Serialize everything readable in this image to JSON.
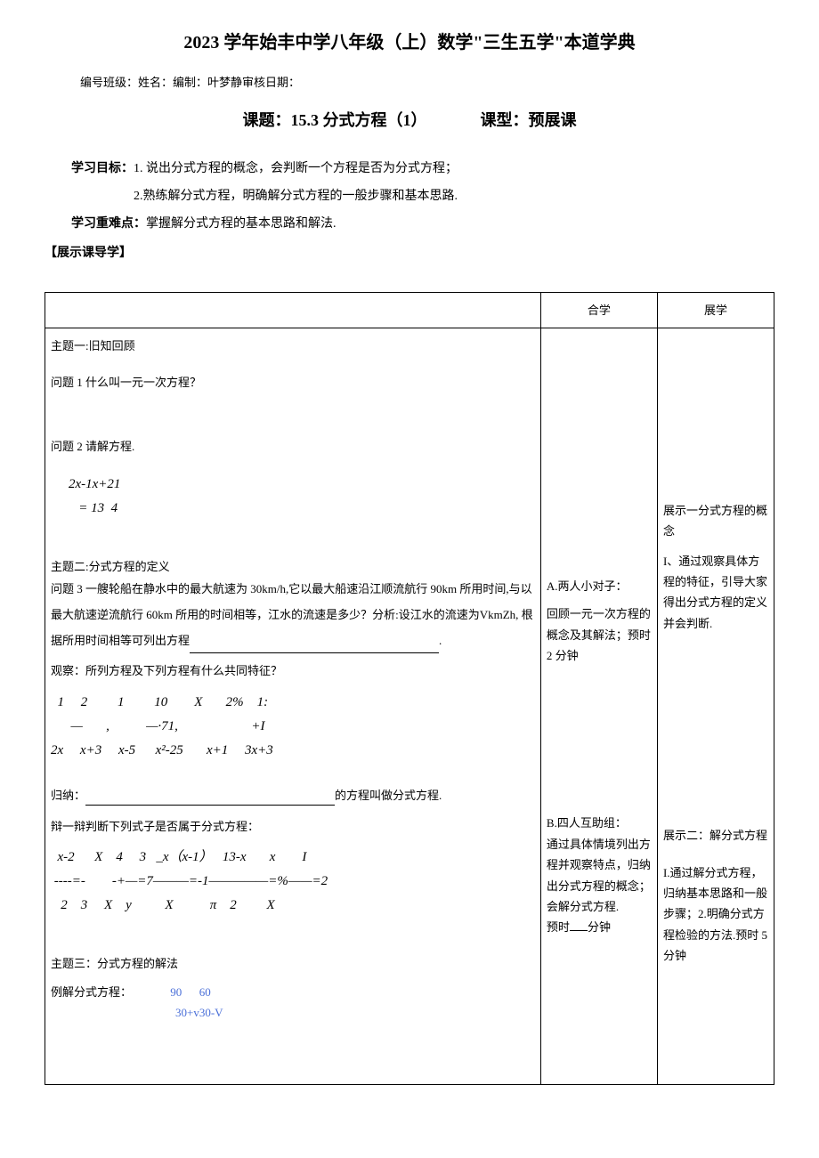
{
  "header": {
    "title": "2023 学年始丰中学八年级（上）数学\"三生五学\"本道学典",
    "meta": "编号班级：姓名：编制：叶梦静审核日期：",
    "topic_label": "课题：15.3 分式方程（1）",
    "type_label": "课型：预展课"
  },
  "objectives": {
    "label": "学习目标：",
    "item1": "1. 说出分式方程的概念，会判断一个方程是否为分式方程；",
    "item2": "2.熟练解分式方程，明确解分式方程的一般步骤和基本思路.",
    "difficulty_label": "学习重难点：",
    "difficulty_text": "掌握解分式方程的基本思路和解法.",
    "guide_tag": "【展示课导学】"
  },
  "table_header": {
    "col2": "合学",
    "col3": "展学"
  },
  "main": {
    "topic1_title": "主题一:旧知回顾",
    "q1": "问题 1 什么叫一元一次方程？",
    "q2": "问题 2 请解方程.",
    "eq1_l1": "2x-1x+21",
    "eq1_l2": "   = 13  4",
    "topic2_title": "主题二:分式方程的定义",
    "q3": "问题 3 一艘轮船在静水中的最大航速为 30km/h,它以最大船速沿江顺流航行 90km 所用时间,与以最大航速逆流航行 60km 所用的时间相等，江水的流速是多少？分析:设江水的流速为VkmZh, 根据所用时间相等可列出方程",
    "q3_tail": ".",
    "observe": "观察：所列方程及下列方程有什么共同特征？",
    "eq2_l1": "  1     2         1         10        X       2%    1:",
    "eq2_l2": "      —       ,           —·71,                      +I",
    "eq2_l3": "2x     x+3     x-5      x²-25       x+1     3x+3",
    "summary_label": "归纳：",
    "summary_tail": "的方程叫做分式方程.",
    "judge_title": "辩一辩判断下列式子是否属于分式方程：",
    "eq3_l1": "  x-2      X    4     3   _x（x-1）   13-x       x        I",
    "eq3_l2": " ----=-        -+—=7———=-1—————=%——=2",
    "eq3_l3": "   2    3     X    y          X           π    2         X",
    "topic3_title": "主题三：分式方程的解法",
    "example_label": "例解分式方程：",
    "eq4_l1": "90      60",
    "eq4_l2": "30+v30-V"
  },
  "mid": {
    "block_a_title": "A.两人小对子：",
    "block_a_text": "回顾一元一次方程的概念及其解法；预时 2 分钟",
    "block_b_title": "B.四人互助组：",
    "block_b_text1": "通过具体情境列出方程并观察特点，归纳出分式方程的概念；",
    "block_b_text2": "会解分式方程.",
    "block_b_text3_pre": "预时",
    "block_b_text3_post": "分钟"
  },
  "right": {
    "show1_title": "展示一分式方程的概念",
    "show1_text": "I、通过观察具体方程的特征，引导大家得出分式方程的定义并会判断.",
    "show2_title": "展示二：解分式方程",
    "show2_text": "I.通过解分式方程，归纳基本思路和一般步骤；2.明确分式方程检验的方法.预时 5分钟"
  }
}
